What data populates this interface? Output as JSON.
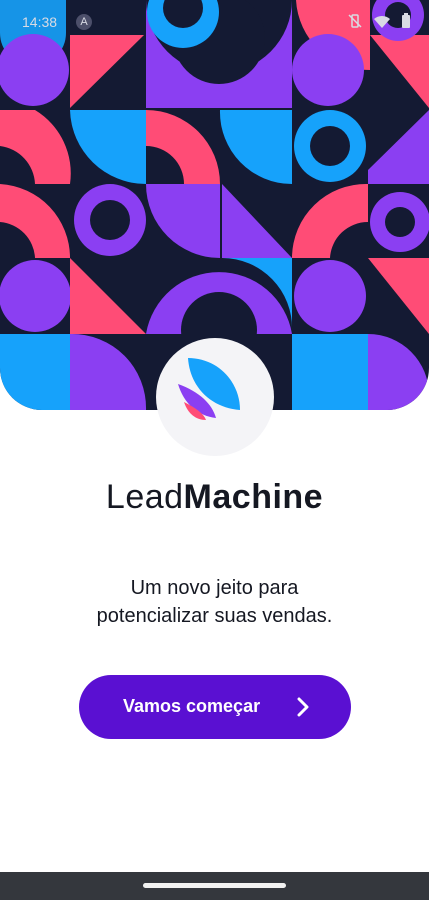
{
  "status_bar": {
    "time": "14:38",
    "app_icon_glyph": "A",
    "icons": [
      "android-app-icon",
      "vibrate-off-icon",
      "wifi-icon",
      "battery-icon"
    ]
  },
  "hero": {
    "pattern_colors": {
      "navy": "#141a33",
      "purple": "#8b3ff2",
      "pink": "#ff4c76",
      "blue": "#16a2fb"
    }
  },
  "logo": {
    "icon": "leaf-logo-icon"
  },
  "brand": {
    "light": "Lead",
    "bold": "Machine"
  },
  "tagline": {
    "line1": "Um novo jeito para",
    "line2": "potencializar suas vendas."
  },
  "cta": {
    "label": "Vamos começar",
    "icon": "chevron-right-icon",
    "color": "#5a10d2"
  }
}
